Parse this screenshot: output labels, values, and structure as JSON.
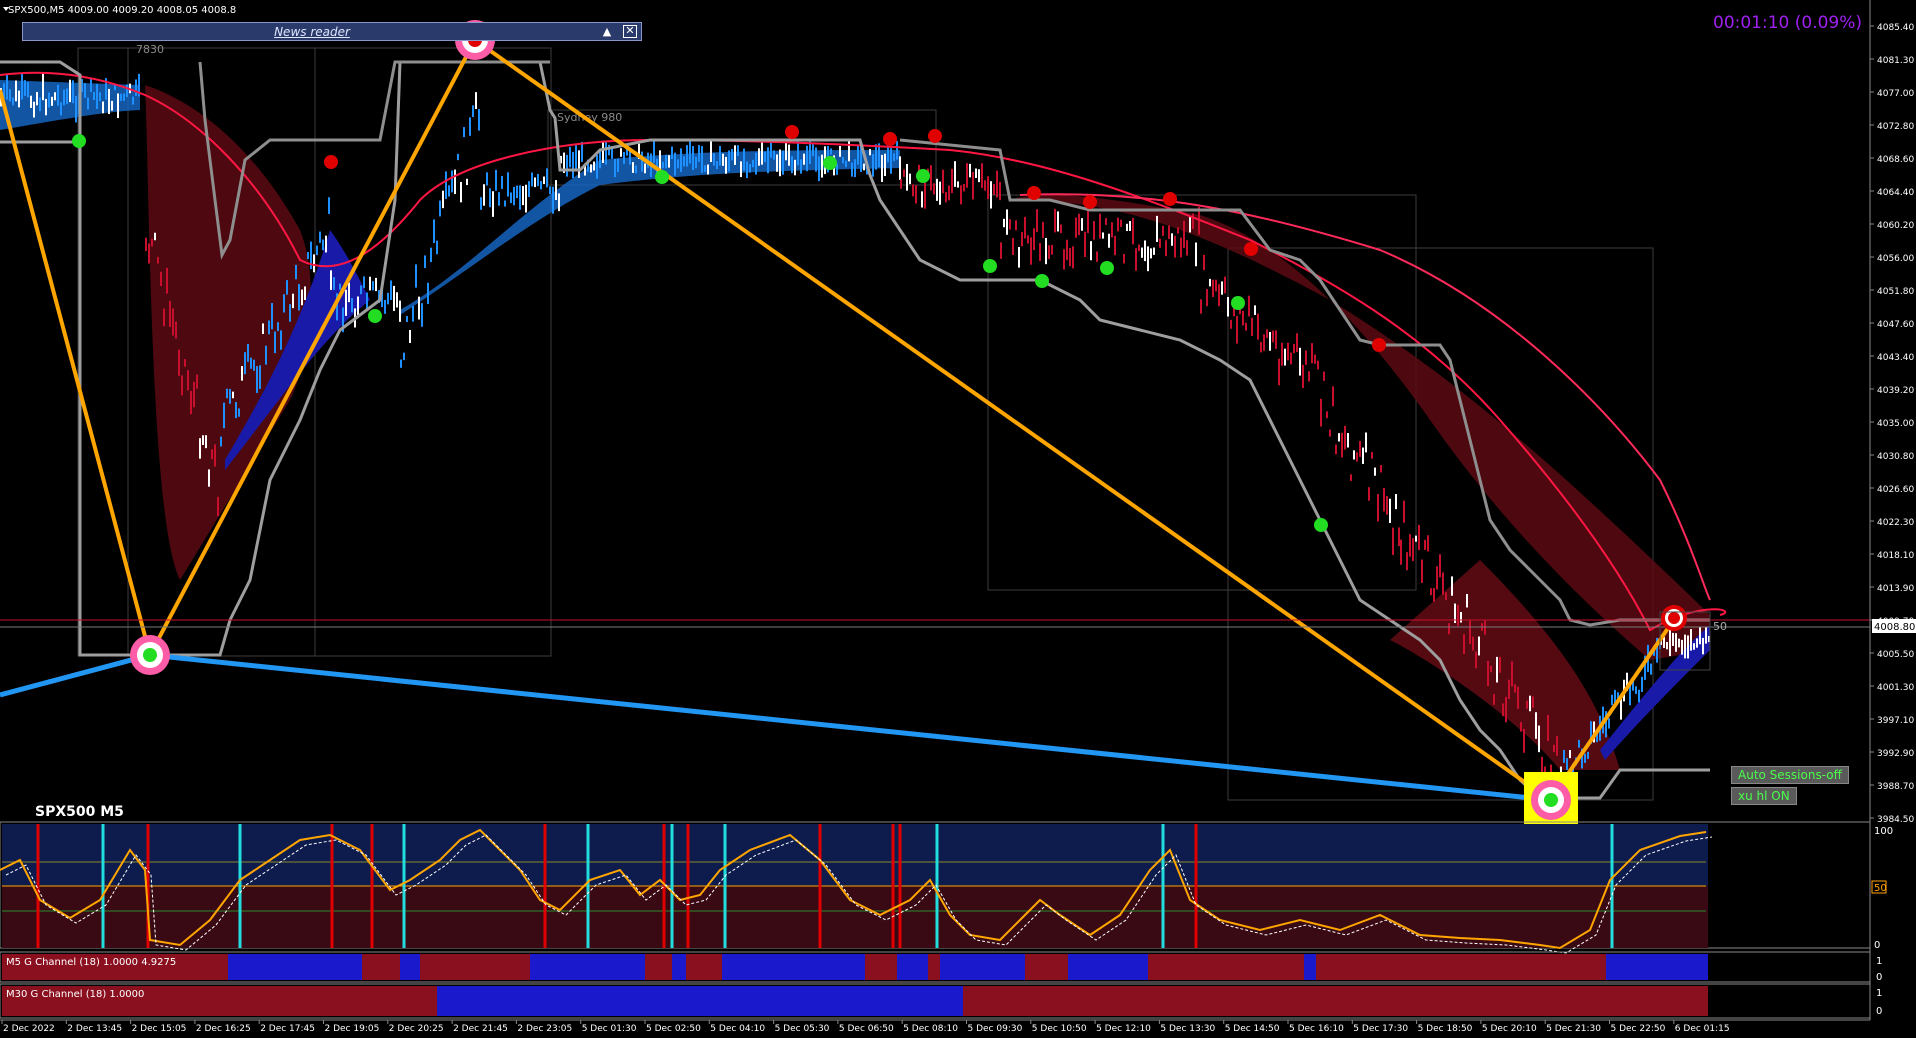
{
  "header": {
    "symbol_info": "SPX500,M5  4009.00 4009.20 4008.05 4008.8",
    "timer": "00:01:10 (0.09%)",
    "chart_label": "SPX500 M5",
    "news_reader": "News reader"
  },
  "labels": {
    "sydney": "Sydney 980",
    "pivot_top": "7830",
    "price_tag": "4008.80",
    "right_mark": "50"
  },
  "buttons": {
    "auto_sessions": "Auto Sessions-off",
    "xu_hl": "xu hl ON"
  },
  "indicators": {
    "m5_channel": "M5  G Channel  (18) 1.0000 4.9275",
    "m30_channel": "M30  G Channel  (18) 1.0000",
    "osc_levels": [
      "100",
      "50",
      "0"
    ],
    "osc_level_tag": "50",
    "bin_levels": [
      "1",
      "0"
    ]
  },
  "price_axis": [
    "4085.40",
    "4081.30",
    "4077.00",
    "4072.80",
    "4068.60",
    "4064.40",
    "4060.20",
    "4056.00",
    "4051.80",
    "4047.60",
    "4043.40",
    "4039.20",
    "4035.00",
    "4030.80",
    "4026.60",
    "4022.30",
    "4018.10",
    "4013.90",
    "4009.70",
    "4005.50",
    "4001.30",
    "3997.10",
    "3992.90",
    "3988.70",
    "3984.50"
  ],
  "time_axis": [
    "2 Dec 2022",
    "2 Dec 13:45",
    "2 Dec 15:05",
    "2 Dec 16:25",
    "2 Dec 17:45",
    "2 Dec 19:05",
    "2 Dec 20:25",
    "2 Dec 21:45",
    "2 Dec 23:05",
    "5 Dec 01:30",
    "5 Dec 02:50",
    "5 Dec 04:10",
    "5 Dec 05:30",
    "5 Dec 06:50",
    "5 Dec 08:10",
    "5 Dec 09:30",
    "5 Dec 10:50",
    "5 Dec 12:10",
    "5 Dec 13:30",
    "5 Dec 14:50",
    "5 Dec 16:10",
    "5 Dec 17:30",
    "5 Dec 18:50",
    "5 Dec 20:10",
    "5 Dec 21:30",
    "5 Dec 22:50",
    "6 Dec 01:15"
  ],
  "colors": {
    "background": "#000000",
    "bull": "#1e90ff",
    "bear": "#c8102e",
    "zigzag": "#ffa500",
    "trend_blue": "#2196f3",
    "ma": "#ff1744",
    "channel": "#9e9e9e",
    "osc_top": "#0d1b4d",
    "osc_bottom": "#3a0a14",
    "timer": "#a020f0",
    "highlight": "#ffff00"
  }
}
